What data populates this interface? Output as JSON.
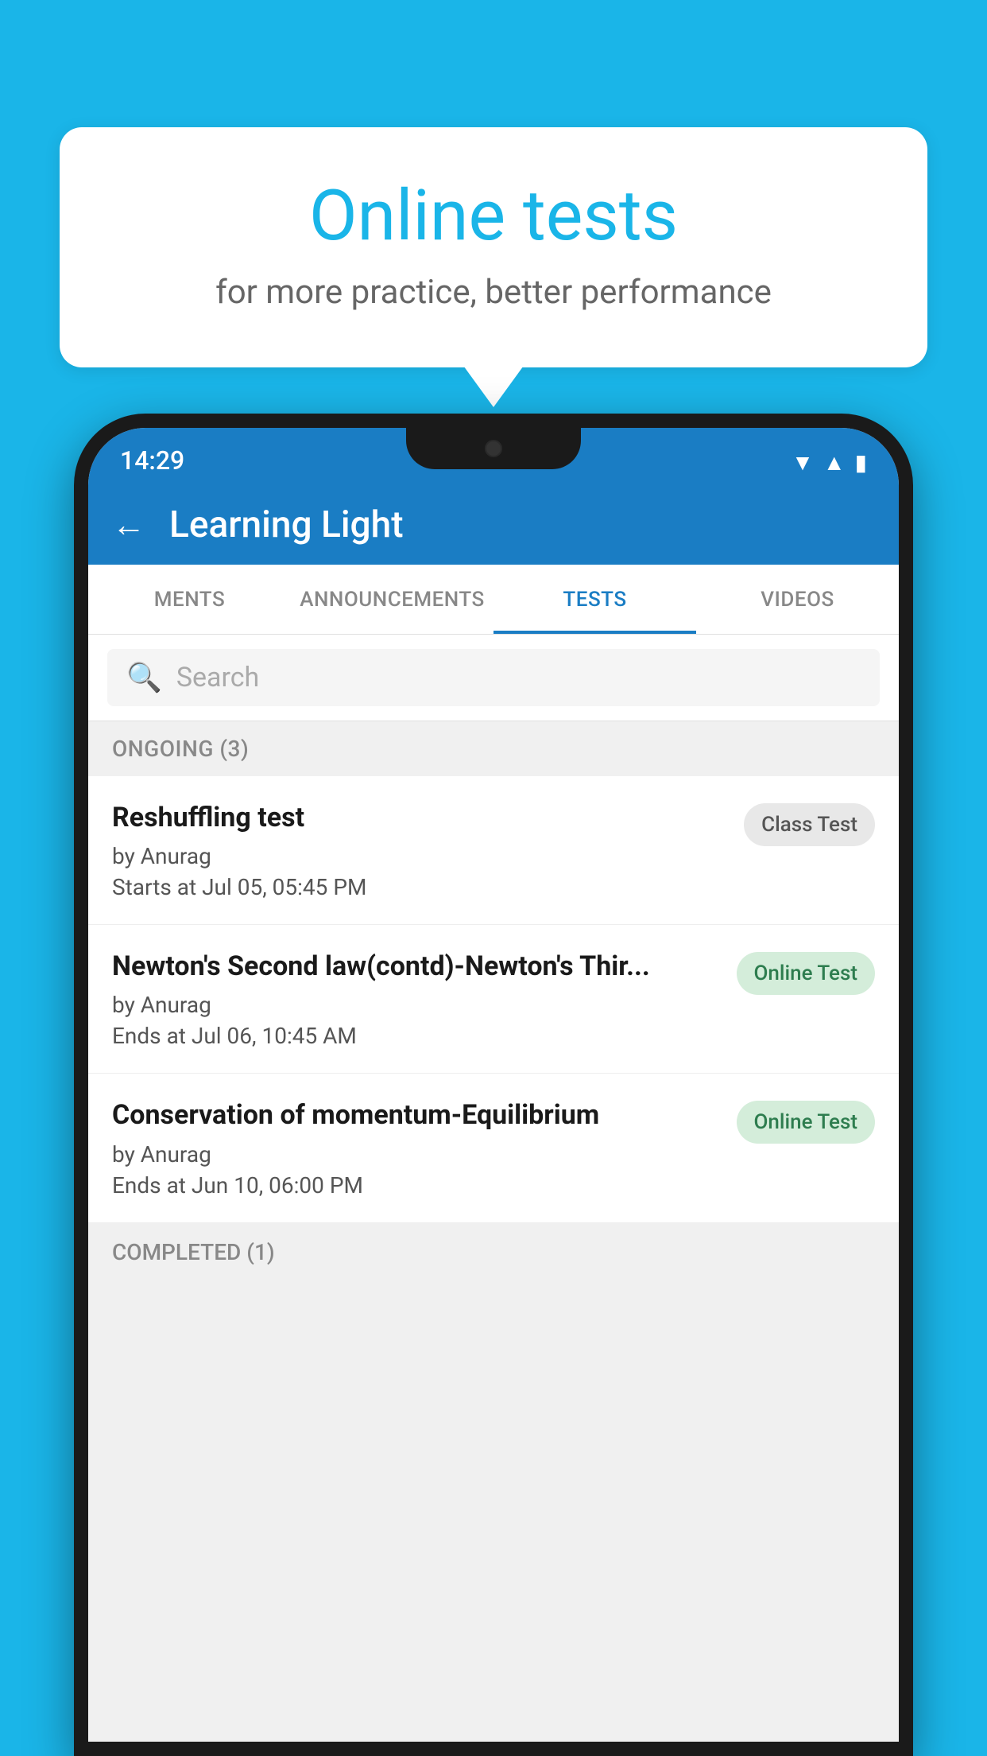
{
  "background_color": "#1ab5e8",
  "bubble": {
    "title": "Online tests",
    "subtitle": "for more practice, better performance"
  },
  "phone": {
    "status_bar": {
      "time": "14:29",
      "wifi": "▼",
      "signal": "▲",
      "battery": "▮"
    },
    "header": {
      "back_label": "←",
      "title": "Learning Light"
    },
    "tabs": [
      {
        "label": "MENTS",
        "active": false
      },
      {
        "label": "ANNOUNCEMENTS",
        "active": false
      },
      {
        "label": "TESTS",
        "active": true
      },
      {
        "label": "VIDEOS",
        "active": false
      }
    ],
    "search": {
      "placeholder": "Search"
    },
    "section_ongoing": {
      "label": "ONGOING (3)"
    },
    "tests": [
      {
        "name": "Reshuffling test",
        "author": "by Anurag",
        "time_label": "Starts at",
        "time": "Jul 05, 05:45 PM",
        "badge": "Class Test",
        "badge_type": "class"
      },
      {
        "name": "Newton's Second law(contd)-Newton's Thir...",
        "author": "by Anurag",
        "time_label": "Ends at",
        "time": "Jul 06, 10:45 AM",
        "badge": "Online Test",
        "badge_type": "online"
      },
      {
        "name": "Conservation of momentum-Equilibrium",
        "author": "by Anurag",
        "time_label": "Ends at",
        "time": "Jun 10, 06:00 PM",
        "badge": "Online Test",
        "badge_type": "online"
      }
    ],
    "section_completed": {
      "label": "COMPLETED (1)"
    }
  }
}
